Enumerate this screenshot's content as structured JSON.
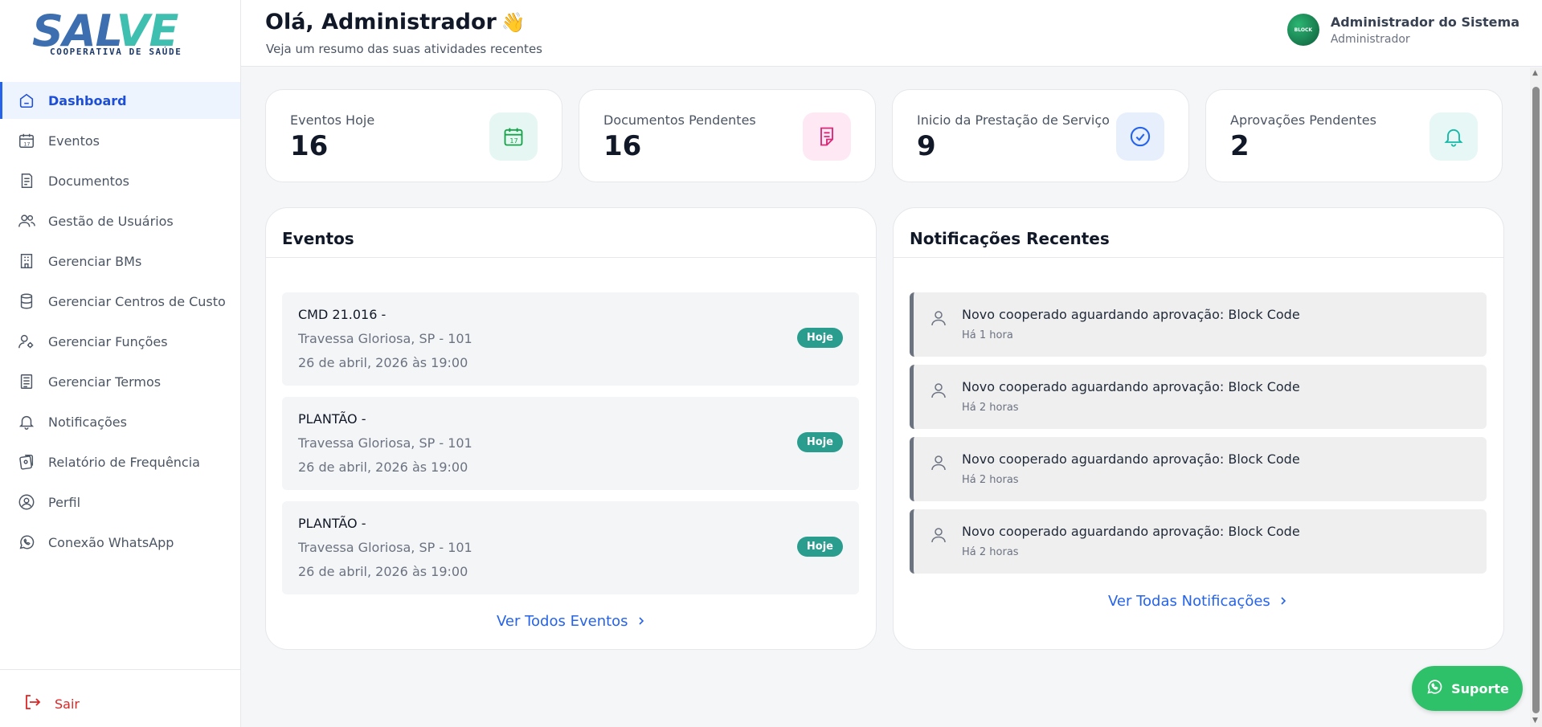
{
  "logo": {
    "brand_main": "SAL",
    "brand_v": "VE",
    "subtitle": "COOPERATIVA DE SAÚDE"
  },
  "sidebar": {
    "items": [
      {
        "label": "Dashboard",
        "icon": "home-icon",
        "active": true
      },
      {
        "label": "Eventos",
        "icon": "calendar-icon"
      },
      {
        "label": "Documentos",
        "icon": "document-icon"
      },
      {
        "label": "Gestão de Usuários",
        "icon": "users-icon"
      },
      {
        "label": "Gerenciar BMs",
        "icon": "building-icon"
      },
      {
        "label": "Gerenciar Centros de Custo",
        "icon": "database-icon"
      },
      {
        "label": "Gerenciar Funções",
        "icon": "user-gear-icon"
      },
      {
        "label": "Gerenciar Termos",
        "icon": "terms-icon"
      },
      {
        "label": "Notificações",
        "icon": "bell-icon"
      },
      {
        "label": "Relatório de Frequência",
        "icon": "report-icon"
      },
      {
        "label": "Perfil",
        "icon": "profile-icon"
      },
      {
        "label": "Conexão WhatsApp",
        "icon": "whatsapp-icon"
      }
    ],
    "logout_label": "Sair"
  },
  "header": {
    "greeting": "Olá, Administrador",
    "emoji": "👋",
    "subtitle": "Veja um resumo das suas atividades recentes",
    "user_name": "Administrador do Sistema",
    "user_role": "Administrador",
    "avatar_text": "BLOCK"
  },
  "stats": [
    {
      "label": "Eventos Hoje",
      "value": "16",
      "icon": "calendar-icon",
      "color": "#16a34a",
      "bg": "#e6f7f3"
    },
    {
      "label": "Documentos Pendentes",
      "value": "16",
      "icon": "document-icon",
      "color": "#db2777",
      "bg": "#fde8f4"
    },
    {
      "label": "Inicio da Prestação de Serviço",
      "value": "9",
      "icon": "check-circle-icon",
      "color": "#2563eb",
      "bg": "#e7effd"
    },
    {
      "label": "Aprovações Pendentes",
      "value": "2",
      "icon": "bell-icon",
      "color": "#14b8a6",
      "bg": "#e6f7f5"
    }
  ],
  "events_card": {
    "title": "Eventos",
    "items": [
      {
        "title": "CMD 21.016 -",
        "address": "Travessa Gloriosa, SP - 101",
        "date": "26 de abril, 2026 às 19:00",
        "badge": "Hoje"
      },
      {
        "title": "PLANTÃO -",
        "address": "Travessa Gloriosa, SP - 101",
        "date": "26 de abril, 2026 às 19:00",
        "badge": "Hoje"
      },
      {
        "title": "PLANTÃO -",
        "address": "Travessa Gloriosa, SP - 101",
        "date": "26 de abril, 2026 às 19:00",
        "badge": "Hoje"
      }
    ],
    "link": "Ver Todos Eventos"
  },
  "notifications_card": {
    "title": "Notificações Recentes",
    "items": [
      {
        "text": "Novo cooperado aguardando aprovação: Block Code",
        "time": "Há 1 hora"
      },
      {
        "text": "Novo cooperado aguardando aprovação: Block Code",
        "time": "Há 2 horas"
      },
      {
        "text": "Novo cooperado aguardando aprovação: Block Code",
        "time": "Há 2 horas"
      },
      {
        "text": "Novo cooperado aguardando aprovação: Block Code",
        "time": "Há 2 horas"
      }
    ],
    "link": "Ver Todas Notificações"
  },
  "support": {
    "label": "Suporte"
  }
}
